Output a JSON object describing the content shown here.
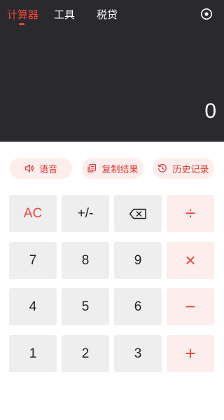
{
  "header": {
    "tabs": [
      {
        "label": "计算器",
        "active": true
      },
      {
        "label": "工具",
        "active": false
      },
      {
        "label": "税贷",
        "active": false
      }
    ],
    "settings_icon": "target-settings-icon"
  },
  "display": {
    "value": "0"
  },
  "actions": {
    "voice": {
      "label": "语音",
      "icon": "speaker-icon"
    },
    "copy": {
      "label": "复制结果",
      "icon": "copy-icon"
    },
    "history": {
      "label": "历史记录",
      "icon": "clock-history-icon"
    }
  },
  "keys": {
    "ac": "AC",
    "sign": "+/-",
    "backspace": "backspace-icon",
    "divide": "÷",
    "seven": "7",
    "eight": "8",
    "nine": "9",
    "multiply": "×",
    "four": "4",
    "five": "5",
    "six": "6",
    "minus": "−",
    "one": "1",
    "two": "2",
    "three": "3",
    "plus": "+"
  },
  "colors": {
    "accent": "#e8453c",
    "header_bg": "#2a2a2e",
    "key_bg": "#eeeeee",
    "op_key_bg": "#fdeeed"
  }
}
